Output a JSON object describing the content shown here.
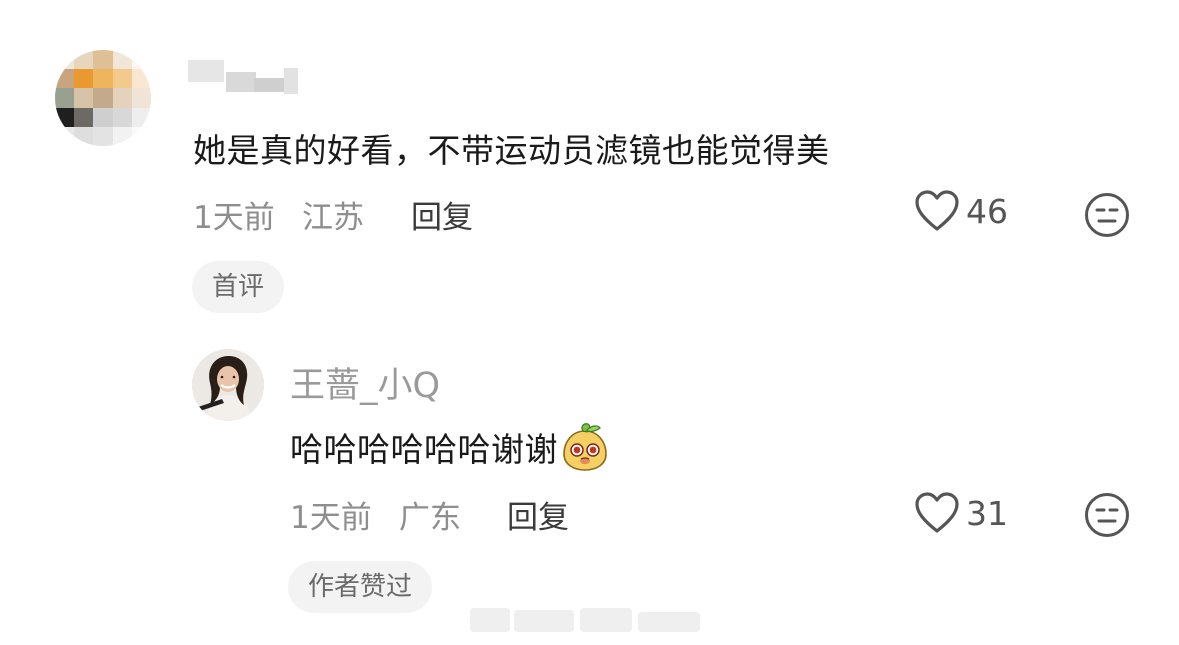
{
  "comments": [
    {
      "author": "",
      "text": "她是真的好看，不带运动员滤镜也能觉得美",
      "time": "1天前",
      "location": "江苏",
      "reply_label": "回复",
      "likes": "46",
      "tag": "首评"
    }
  ],
  "reply": {
    "author": "王蔷_小Q",
    "text": "哈哈哈哈哈哈谢谢",
    "emoji": "cute-mango-face-emoji",
    "time": "1天前",
    "location": "广东",
    "reply_label": "回复",
    "likes": "31",
    "tag": "作者赞过"
  },
  "icons": {
    "like": "heart-outline-icon",
    "reaction": "neutral-face-icon"
  },
  "colors": {
    "text": "#1a1a1a",
    "meta": "#8e8e8e",
    "tag_bg": "#f3f3f3"
  }
}
